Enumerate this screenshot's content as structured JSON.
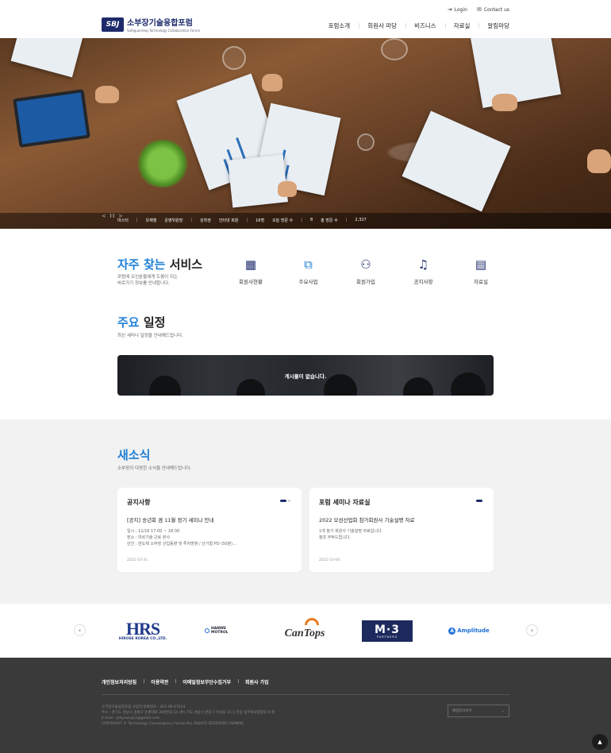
{
  "header": {
    "util": [
      {
        "icon": "login-icon",
        "label": "Login"
      },
      {
        "icon": "contact-icon",
        "label": "Contact us"
      }
    ],
    "logo_mark": "SBJ",
    "logo_title": "소부장기술융합포럼",
    "logo_subtitle": "Safeguarding Technology Collaboration Forum",
    "nav": [
      "포럼소개",
      "회원사 마당",
      "비즈니스",
      "자료실",
      "알림마당"
    ]
  },
  "hero": {
    "controls": "< II >",
    "stats": [
      "마스터",
      "유제행",
      "운영위원장",
      "성학권",
      "인터넷 회원",
      "16명",
      "오늘 방문 수",
      "8",
      "총 방문 수",
      "2,327"
    ]
  },
  "services": {
    "title_accent": "자주 찾는",
    "title_rest": " 서비스",
    "desc_line1": "포럼에 오신분들에게 도움이 되는",
    "desc_line2": "바로가기 정보를 안내합니다.",
    "items": [
      {
        "icon": "calendar-icon",
        "glyph": "▦",
        "label": "회원사현황"
      },
      {
        "icon": "org-chart-icon",
        "glyph": "⧉",
        "label": "주요사업"
      },
      {
        "icon": "user-add-icon",
        "glyph": "⚇",
        "label": "회원가입"
      },
      {
        "icon": "bell-icon",
        "glyph": "♫",
        "label": "공지사항"
      },
      {
        "icon": "document-icon",
        "glyph": "▤",
        "label": "자료실"
      }
    ]
  },
  "schedule": {
    "title_accent": "주요",
    "title_rest": " 일정",
    "desc": "최신 세미나 일정을 안내해드립니다.",
    "empty_message": "게시물이 없습니다."
  },
  "news": {
    "title": "새소식",
    "desc": "소부장의 다양한 소식을 안내해드립니다.",
    "cards": [
      {
        "heading": "공지사항",
        "subject": "[공지] 송년회 겸 11월 정기 세미나 안내",
        "lines": [
          "일시 : 11/16 17:00 ~ 18:30",
          "장소 : 미르기술 근로 본사",
          "안건 : 반도체 소부장 산업동향 및 투자방향 / 산기협 PD (50분)..."
        ],
        "date": "2022-10-31"
      },
      {
        "heading": "포럼 세미나 자료실",
        "subject": "2022 모션산업회 참가회원사 기술설명 자료",
        "lines": [
          "1개 참가 회원사 기술설명 자료입니다.",
          "",
          "참조 부탁드립니다."
        ],
        "date": "2022-10-04"
      }
    ]
  },
  "partners": {
    "prev": "‹",
    "next": "›",
    "hrs_big": "HRS",
    "hrs_small": "HIROSE KOREA CO.,LTD.",
    "hanwa": "HANWE MOTROL",
    "cantops": "CanTops",
    "m3_big": "M·3",
    "m3_small": "PARTNERS",
    "amplitude": "Amplitude"
  },
  "footer": {
    "links": [
      "개인정보처리방침",
      "이용약관",
      "이메일정보무단수집거부",
      "회원사 가입"
    ],
    "info_line1": "소부장기술융합포럼   사업자 등록번호 : 415-00-47614",
    "info_line2": "주소 : 경기도 성남시 중원구 둔촌대로 200번길 14 (위) 기도 성남시 분당구 수내동 15-1 분당 동부로보험빌딩 9 층",
    "info_line3": "E-mail : jehyeong11@gmail.com",
    "info_line4": "COPYRIGHT © Technology Convergency Forum ALL RIGHTS RESERVED [ADMIN]",
    "family_select": "패밀리사이트"
  }
}
